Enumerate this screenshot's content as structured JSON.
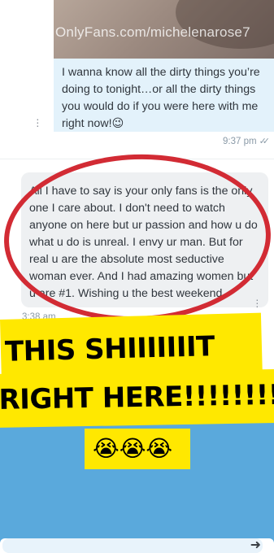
{
  "incoming_photo": {
    "watermark": "OnlyFans.com/michelenarose7"
  },
  "outgoing_message": {
    "text": "I wanna know all the dirty things you’re doing to tonight…or all the dirty things you would do if you were here with me right now!😉",
    "time": "9:37 pm",
    "read_icon": "double-check-icon"
  },
  "reply_message": {
    "text": "All I have to say is your only fans is the only one I care about. I don't need to watch anyone on here but ur passion and how u do what u do is unreal. I envy ur man. But for real u are the absolute most seductive woman ever. And I had amazing women but u are #1. Wishing u the best weekend",
    "time": "3:38 am"
  },
  "overlay": {
    "caption_line1": "THIS SHIIIIIIIT",
    "caption_line2": "RIGHT HERE!!!!!!!!",
    "emojis": "😭😭😭",
    "circle_color": "#d22b34",
    "banner_color": "#ffe800"
  },
  "colors": {
    "sent_bubble": "#e3f2fb",
    "received_bubble": "#eef0f2",
    "background_blue": "#5aa9dc"
  }
}
